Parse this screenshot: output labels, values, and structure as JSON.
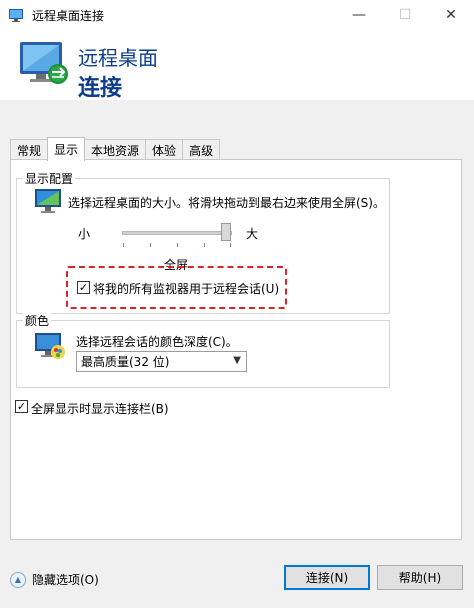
{
  "window": {
    "title": "远程桌面连接",
    "minimize_glyph": "—",
    "maximize_glyph": "☐",
    "close_glyph": "✕"
  },
  "banner": {
    "line1": "远程桌面",
    "line2": "连接"
  },
  "tabs": [
    {
      "label": "常规",
      "active": false
    },
    {
      "label": "显示",
      "active": true
    },
    {
      "label": "本地资源",
      "active": false
    },
    {
      "label": "体验",
      "active": false
    },
    {
      "label": "高级",
      "active": false
    }
  ],
  "display_config": {
    "group_label": "显示配置",
    "description": "选择远程桌面的大小。将滑块拖动到最右边来使用全屏(S)。",
    "small_label": "小",
    "large_label": "大",
    "slider_value_label": "全屏",
    "slider_value": 1.0,
    "multimon_checkbox_label": "将我的所有监视器用于远程会话(U)",
    "multimon_checked": true
  },
  "colors": {
    "group_label": "颜色",
    "description": "选择远程会话的颜色深度(C)。",
    "depth_selected": "最高质量(32 位)"
  },
  "fullscreen_bar": {
    "label": "全屏显示时显示连接栏(B)",
    "checked": true
  },
  "footer": {
    "hide_options": "隐藏选项(O)",
    "connect": "连接(N)",
    "help": "帮助(H)"
  },
  "accent": {
    "highlight_border": "#d9252a",
    "title_blue": "#0c3d8a",
    "primary_button_border": "#0078d7"
  }
}
